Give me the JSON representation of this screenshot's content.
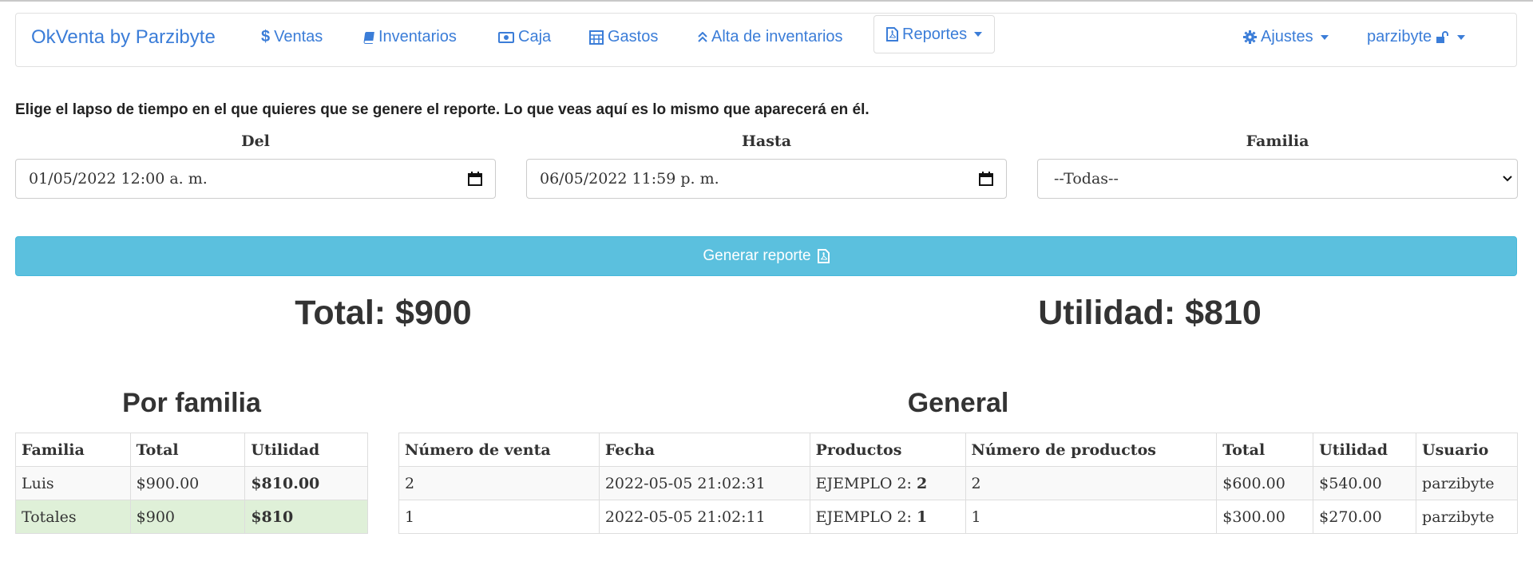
{
  "nav": {
    "brand": "OkVenta by Parzibyte",
    "items": [
      {
        "label": "Ventas",
        "icon": "dollar-icon"
      },
      {
        "label": "Inventarios",
        "icon": "book-icon"
      },
      {
        "label": "Caja",
        "icon": "money-bill-icon"
      },
      {
        "label": "Gastos",
        "icon": "calculator-icon"
      },
      {
        "label": "Alta de inventarios",
        "icon": "double-chevron-up-icon"
      },
      {
        "label": "Reportes",
        "icon": "file-pdf-icon"
      }
    ],
    "settings_label": "Ajustes",
    "user_label": "parzibyte",
    "accent_color": "#3b7dd8"
  },
  "intro_text": "Elige el lapso de tiempo en el que quieres que se genere el reporte. Lo que veas aquí es lo mismo que aparecerá en él.",
  "filters": {
    "from_label": "Del",
    "from_value": "01/05/2022 12:00 a. m.",
    "to_label": "Hasta",
    "to_value": "06/05/2022 11:59 p. m.",
    "family_label": "Familia",
    "family_value": "--Todas--"
  },
  "generate_button": {
    "label": "Generar reporte",
    "color": "#5bc0de"
  },
  "summary": {
    "total": "Total: $900",
    "utilidad": "Utilidad: $810"
  },
  "by_family": {
    "title": "Por familia",
    "headers": [
      "Familia",
      "Total",
      "Utilidad"
    ],
    "rows": [
      [
        "Luis",
        "$900.00",
        "$810.00"
      ]
    ],
    "totals": [
      "Totales",
      "$900",
      "$810"
    ]
  },
  "general": {
    "title": "General",
    "headers": [
      "Número de venta",
      "Fecha",
      "Productos",
      "Número de productos",
      "Total",
      "Utilidad",
      "Usuario"
    ],
    "rows": [
      {
        "venta": "2",
        "fecha": "2022-05-05 21:02:31",
        "producto": "EJEMPLO 2:",
        "cantidad": "2",
        "num_productos": "2",
        "total": "$600.00",
        "utilidad": "$540.00",
        "usuario": "parzibyte"
      },
      {
        "venta": "1",
        "fecha": "2022-05-05 21:02:11",
        "producto": "EJEMPLO 2:",
        "cantidad": "1",
        "num_productos": "1",
        "total": "$300.00",
        "utilidad": "$270.00",
        "usuario": "parzibyte"
      }
    ]
  }
}
